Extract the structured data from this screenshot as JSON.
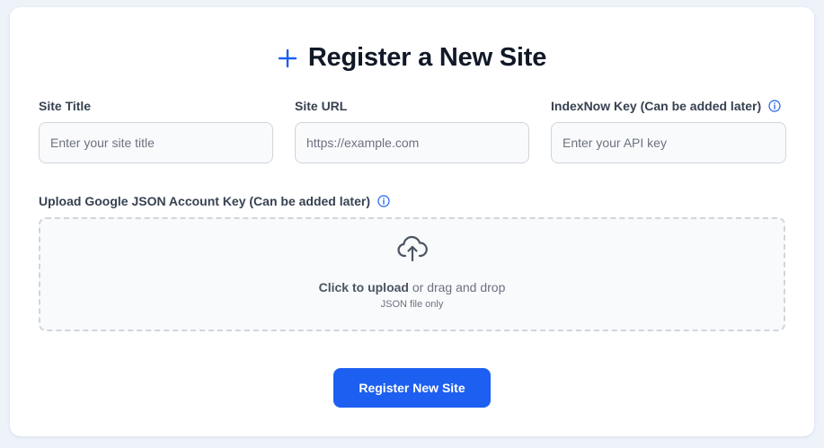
{
  "form": {
    "title": "Register a New Site",
    "title_icon": "plus-icon",
    "accent_color": "#1d5ff0",
    "fields": {
      "site_title": {
        "label": "Site Title",
        "placeholder": "Enter your site title",
        "value": ""
      },
      "site_url": {
        "label": "Site URL",
        "placeholder": "https://example.com",
        "value": ""
      },
      "indexnow_key": {
        "label": "IndexNow Key (Can be added later)",
        "placeholder": "Enter your API key",
        "value": "",
        "info_icon": "info-icon"
      }
    },
    "upload": {
      "label": "Upload Google JSON Account Key (Can be added later)",
      "info_icon": "info-icon",
      "icon": "cloud-upload-icon",
      "click_text": "Click to upload",
      "drag_text": " or drag and drop",
      "hint": "JSON file only"
    },
    "submit_label": "Register New Site"
  }
}
